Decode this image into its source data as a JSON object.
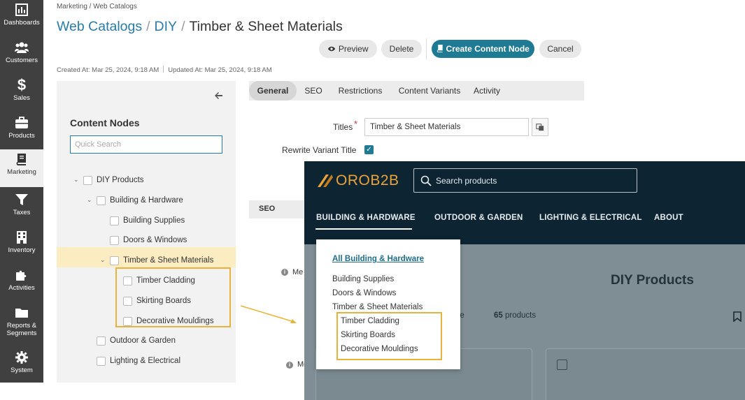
{
  "sidebar": {
    "items": [
      {
        "label": "Dashboards",
        "icon": "chart-bar-icon"
      },
      {
        "label": "Customers",
        "icon": "users-icon"
      },
      {
        "label": "Sales",
        "icon": "dollar-icon"
      },
      {
        "label": "Products",
        "icon": "briefcase-icon"
      },
      {
        "label": "Marketing",
        "icon": "book-icon",
        "active": true
      },
      {
        "label": "Taxes",
        "icon": "funnel-icon"
      },
      {
        "label": "Inventory",
        "icon": "building-icon"
      },
      {
        "label": "Activities",
        "icon": "puzzle-icon"
      },
      {
        "label": "Reports &",
        "label2": "Segments",
        "icon": "folder-icon"
      },
      {
        "label": "System",
        "icon": "gear-icon"
      }
    ]
  },
  "header": {
    "breadcrumb": "Marketing / Web Catalogs",
    "title_parts": [
      "Web Catalogs",
      "DIY",
      "Timber & Sheet Materials"
    ],
    "separator": "/",
    "buttons": {
      "preview": "Preview",
      "delete": "Delete",
      "create": "Create Content Node",
      "cancel": "Cancel"
    },
    "created_at": "Created At: Mar 25, 2024, 9:18 AM",
    "updated_at": "Updated At: Mar 25, 2024, 9:18 AM"
  },
  "tree": {
    "title": "Content Nodes",
    "search_placeholder": "Quick Search",
    "nodes": [
      "DIY Products",
      "Building & Hardware",
      "Building Supplies",
      "Doors & Windows",
      "Timber & Sheet Materials",
      "Timber Cladding",
      "Skirting Boards",
      "Decorative Mouldings",
      "Outdoor & Garden",
      "Lighting & Electrical"
    ]
  },
  "tabs": [
    "General",
    "SEO",
    "Restrictions",
    "Content Variants",
    "Activity"
  ],
  "form": {
    "titles_label": "Titles",
    "required_mark": "*",
    "titles_value": "Timber & Sheet Materials",
    "rewrite_label": "Rewrite Variant Title",
    "rewrite_checked": true,
    "seo_section": "SEO",
    "me_trunc_1": "Me",
    "me_trunc_2": "Me"
  },
  "storefront": {
    "logo": "OROB2B",
    "search_placeholder": "Search products",
    "nav": [
      "BUILDING & HARDWARE",
      "OUTDOOR & GARDEN",
      "LIGHTING & ELECTRICAL",
      "ABOUT"
    ],
    "dropdown": {
      "all": "All Building & Hardware",
      "items": [
        "Building Supplies",
        "Doors & Windows",
        "Timber & Sheet Materials"
      ],
      "sub_items": [
        "Timber Cladding",
        "Skirting Boards",
        "Decorative Mouldings"
      ]
    },
    "page_title": "DIY Products",
    "count_number": "65",
    "count_suffix": " products",
    "trunc_ge": "ge"
  },
  "colors": {
    "sidebar_bg": "#404040",
    "link_blue": "#2a7aa8",
    "primary_teal": "#1f7a93",
    "highlight_yellow": "#fcecc2",
    "box_border": "#e8b33a",
    "store_header": "#0d2433",
    "logo_orange": "#e8a43a"
  }
}
